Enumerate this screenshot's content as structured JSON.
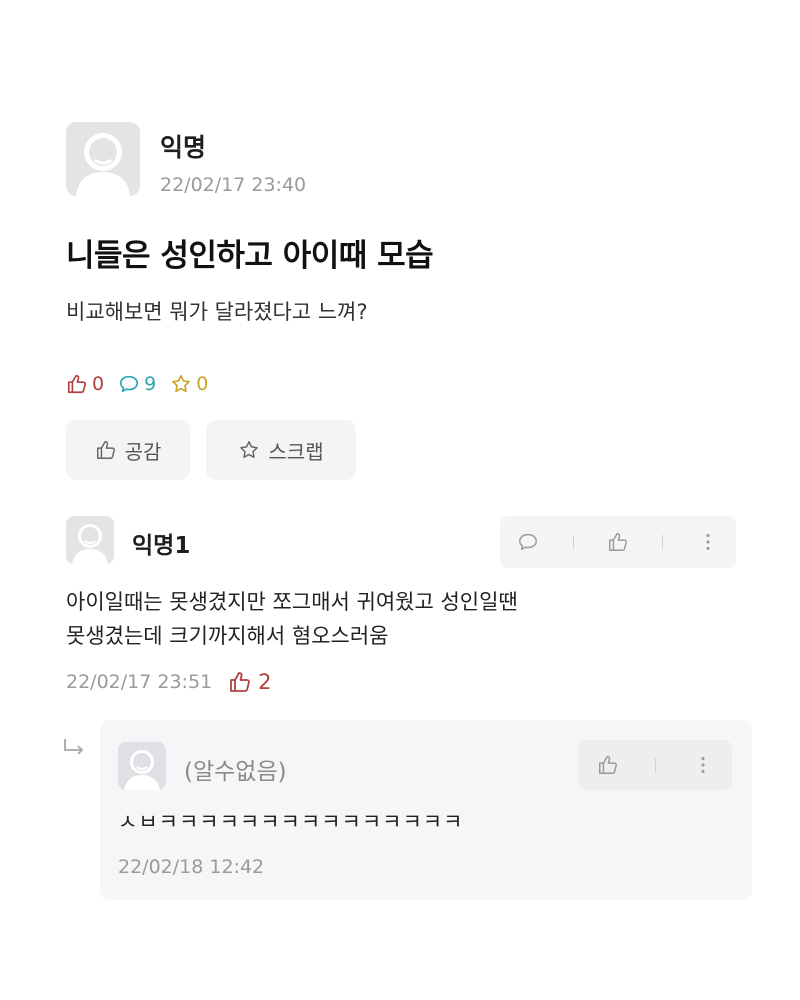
{
  "post": {
    "author": "익명",
    "date": "22/02/17 23:40",
    "title": "니들은 성인하고 아이때 모습",
    "body": "비교해보면 뭐가 달라졌다고 느껴?",
    "stats": {
      "likes": "0",
      "comments": "9",
      "scraps": "0"
    },
    "buttons": {
      "like_label": "공감",
      "scrap_label": "스크랩"
    }
  },
  "comments": [
    {
      "author": "익명1",
      "text_line1": "아이일때는 못생겼지만 쪼그매서 귀여웠고 성인일땐",
      "text_line2": "못생겼는데 크기까지해서 혐오스러움",
      "date": "22/02/17 23:51",
      "likes": "2",
      "reply": {
        "author": "(알수없음)",
        "text": "ㅅㅂㅋㅋㅋㅋㅋㅋㅋㅋㅋㅋㅋㅋㅋㅋㅋ",
        "date": "22/02/18 12:42"
      }
    }
  ],
  "colors": {
    "like": "#b0413e",
    "comment": "#2aa6b0",
    "scrap": "#caa424"
  },
  "icons": {
    "like": "thumbs-up-icon",
    "comment": "speech-bubble-icon",
    "scrap": "star-icon",
    "more": "vertical-dots-icon",
    "reply": "reply-arrow-icon"
  }
}
